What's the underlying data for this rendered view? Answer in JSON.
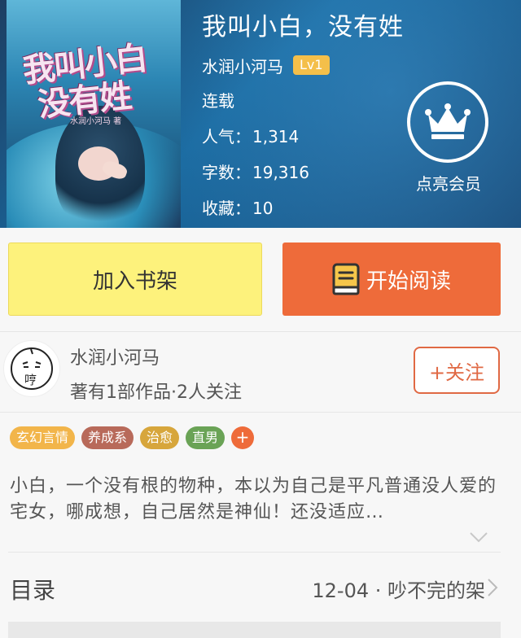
{
  "book": {
    "title": "我叫小白，没有姓",
    "author": "水润小河马",
    "level_badge": "Lv1",
    "status": "连载",
    "popularity_label": "人气：",
    "popularity_value": "1,314",
    "word_count_label": "字数：",
    "word_count_value": "19,316",
    "favorites_label": "收藏：",
    "favorites_value": "10",
    "cover_title_line1": "我叫小白",
    "cover_title_line2": "没有姓",
    "cover_author": "水润小河马 著"
  },
  "vip": {
    "label": "点亮会员",
    "icon": "crown-icon"
  },
  "actions": {
    "add_to_shelf": "加入书架",
    "start_reading": "开始阅读",
    "read_icon": "book-icon"
  },
  "author_block": {
    "name": "水润小河马",
    "stats": "著有1部作品·2人关注",
    "follow": "+关注",
    "avatar_text": "哼"
  },
  "tags": [
    {
      "label": "玄幻言情",
      "color": "#f2b54a"
    },
    {
      "label": "养成系",
      "color": "#b86a5a"
    },
    {
      "label": "治愈",
      "color": "#d7a63c"
    },
    {
      "label": "直男",
      "color": "#6aa356"
    }
  ],
  "tag_add": "+",
  "description": "小白，一个没有根的物种，本以为自己是平凡普通没人爱的宅女，哪成想，自己居然是神仙！还没适应…",
  "toc": {
    "label": "目录",
    "latest": "12-04 · 吵不完的架"
  },
  "colors": {
    "accent": "#ee6b3a",
    "shelf_button": "#fdf27c",
    "level_badge": "#f4bf4a"
  }
}
